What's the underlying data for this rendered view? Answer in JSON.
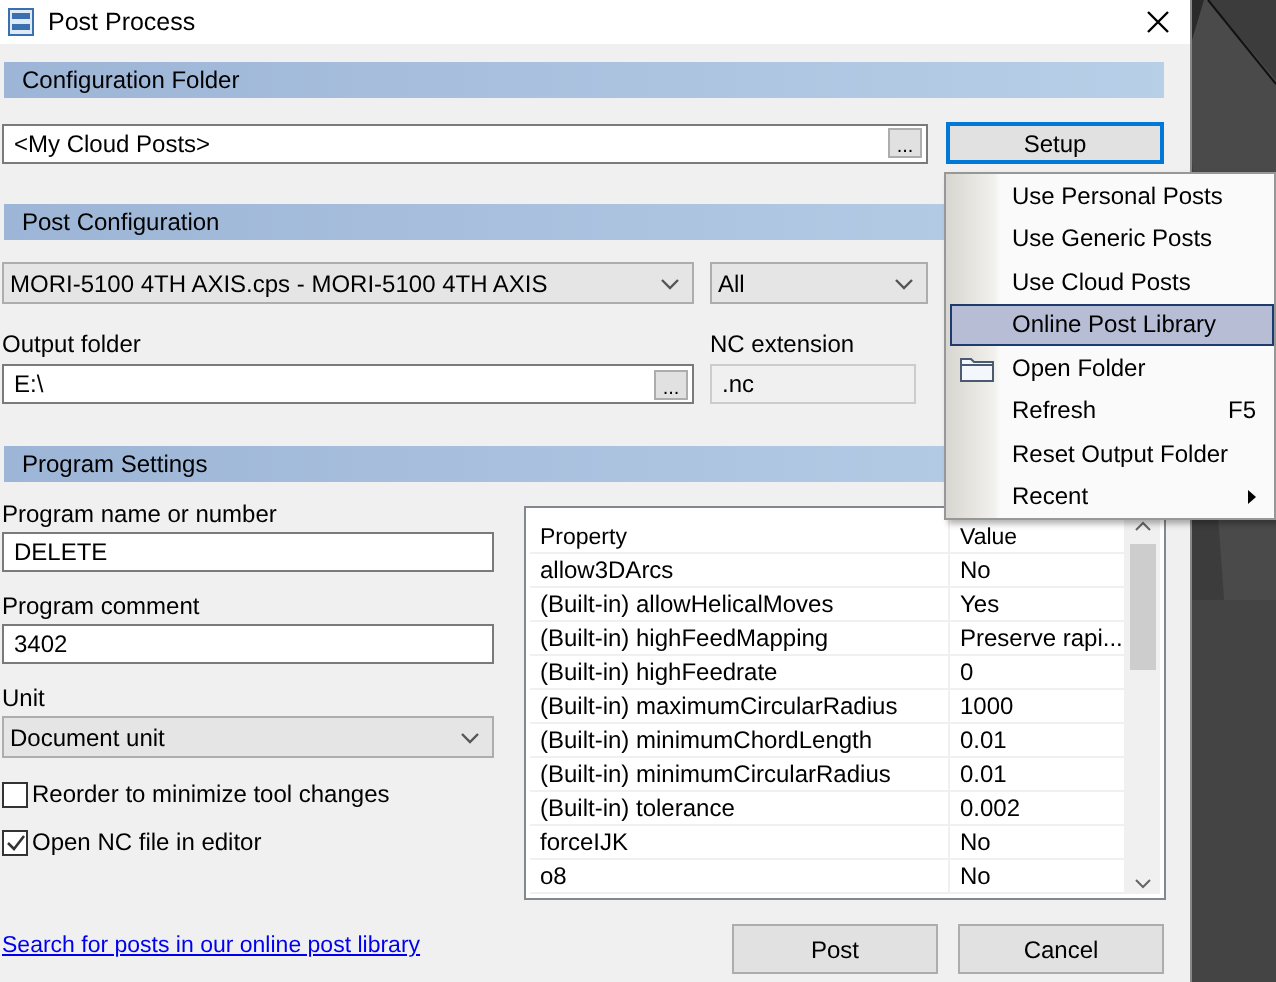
{
  "window": {
    "title": "Post Process"
  },
  "configuration_folder": {
    "header": "Configuration Folder",
    "folder": "<My Cloud Posts>",
    "browse": "...",
    "setup_button": "Setup"
  },
  "setup_menu": {
    "items": [
      {
        "label": "Use Personal Posts",
        "kind": "plain",
        "selected": false
      },
      {
        "label": "Use Generic Posts",
        "kind": "plain",
        "selected": false
      },
      {
        "label": "Use Cloud Posts",
        "kind": "plain",
        "selected": false
      },
      {
        "label": "Online Post Library",
        "kind": "plain",
        "selected": true
      },
      {
        "label": "Open Folder",
        "kind": "folder",
        "selected": false
      },
      {
        "label": "Refresh",
        "kind": "shortcut",
        "shortcut": "F5",
        "selected": false
      },
      {
        "label": "Reset Output Folder",
        "kind": "plain",
        "selected": false
      },
      {
        "label": "Recent",
        "kind": "submenu",
        "selected": false
      }
    ]
  },
  "post_configuration": {
    "header": "Post Configuration",
    "post": "MORI-5100 4TH AXIS.cps - MORI-5100 4TH AXIS",
    "filter": "All",
    "output_folder_label": "Output folder",
    "output_folder": "E:\\",
    "browse": "...",
    "nc_extension_label": "NC extension",
    "nc_extension": ".nc"
  },
  "program_settings": {
    "header": "Program Settings",
    "fields": [
      {
        "label": "Program name or number",
        "value": "DELETE"
      },
      {
        "label": "Program comment",
        "value": "3402"
      }
    ],
    "unit_label": "Unit",
    "unit": "Document unit",
    "options": [
      {
        "label": "Reorder to minimize tool changes",
        "checked": false
      },
      {
        "label": "Open NC file in editor",
        "checked": true
      }
    ],
    "properties": {
      "columns": [
        "Property",
        "Value"
      ],
      "rows": [
        {
          "property": "allow3DArcs",
          "value": "No"
        },
        {
          "property": "(Built-in) allowHelicalMoves",
          "value": "Yes"
        },
        {
          "property": "(Built-in) highFeedMapping",
          "value": "Preserve rapi..."
        },
        {
          "property": "(Built-in) highFeedrate",
          "value": "0"
        },
        {
          "property": "(Built-in) maximumCircularRadius",
          "value": "1000"
        },
        {
          "property": "(Built-in) minimumChordLength",
          "value": "0.01"
        },
        {
          "property": "(Built-in) minimumCircularRadius",
          "value": "0.01"
        },
        {
          "property": "(Built-in) tolerance",
          "value": "0.002"
        },
        {
          "property": "forceIJK",
          "value": "No"
        },
        {
          "property": "o8",
          "value": "No"
        }
      ]
    }
  },
  "link": "Search for posts in our online post library",
  "buttons": [
    "Post",
    "Cancel"
  ]
}
